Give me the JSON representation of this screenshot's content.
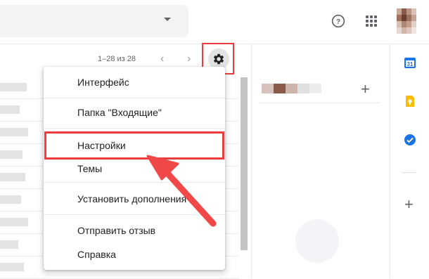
{
  "topbar": {
    "help_icon": "help-circle-icon",
    "apps_icon": "apps-grid-icon"
  },
  "toolbar": {
    "pagination": "1–28 из 28",
    "prev_icon": "‹",
    "next_icon": "›",
    "settings_icon": "gear-icon"
  },
  "menu": {
    "items": [
      {
        "label": "Интерфейс"
      },
      {
        "label": "Папка \"Входящие\""
      },
      {
        "label": "Настройки"
      },
      {
        "label": "Темы"
      },
      {
        "label": "Установить дополнения"
      },
      {
        "label": "Отправить отзыв"
      },
      {
        "label": "Справка"
      }
    ]
  },
  "right_panel": {
    "add_contact": "+"
  },
  "side_panel": {
    "add_label": "+",
    "icons": [
      "calendar-icon",
      "keep-icon",
      "tasks-icon"
    ]
  },
  "colors": {
    "highlight": "#ef3b3b",
    "calendar": "#1a73e8",
    "keep": "#fbbc04",
    "tasks": "#1a73e8"
  }
}
